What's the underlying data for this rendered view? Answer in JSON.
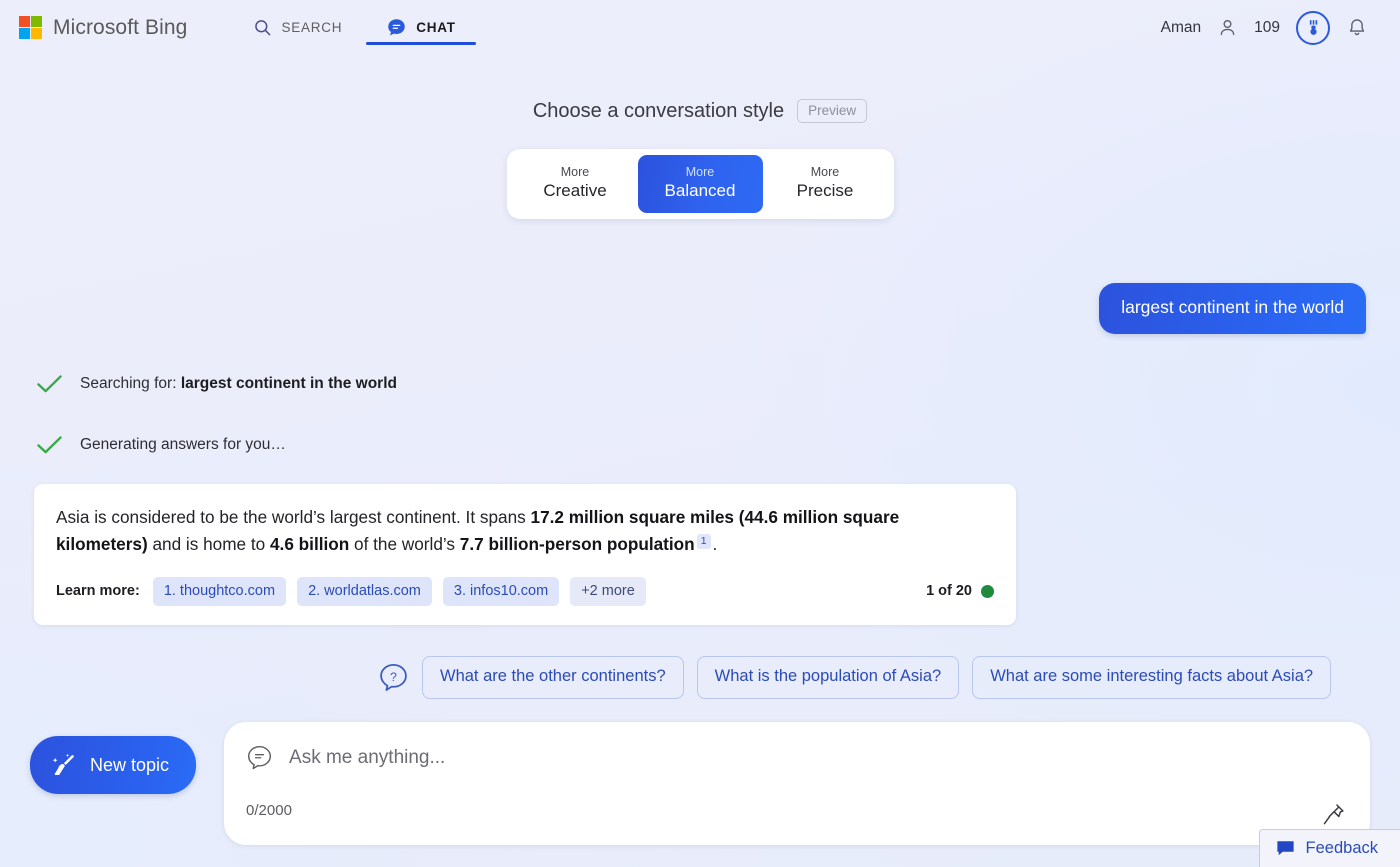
{
  "nav": {
    "brand": "Microsoft Bing",
    "brand_logo_icon": "microsoft-logo-icon",
    "tabs": [
      {
        "label": "SEARCH",
        "icon": "search-icon",
        "active": false
      },
      {
        "label": "CHAT",
        "icon": "chat-bubble-icon",
        "active": true
      }
    ],
    "account_name": "Aman",
    "account_icon": "person-icon",
    "points": "109",
    "rewards_icon": "rewards-medal-icon",
    "notifications_icon": "bell-icon"
  },
  "style_picker": {
    "title": "Choose a conversation style",
    "preview_badge": "Preview",
    "options": [
      {
        "small": "More",
        "large": "Creative",
        "selected": false
      },
      {
        "small": "More",
        "large": "Balanced",
        "selected": true
      },
      {
        "small": "More",
        "large": "Precise",
        "selected": false
      }
    ],
    "selected_index": 1
  },
  "conversation": {
    "user_message": "largest continent in the world",
    "status_lines": [
      {
        "icon": "check-icon",
        "prefix": "Searching for: ",
        "bold": "largest continent in the world"
      },
      {
        "icon": "check-icon",
        "prefix": "Generating answers for you…",
        "bold": ""
      }
    ],
    "answer": {
      "segments": [
        {
          "text": "Asia is considered to be the world’s largest continent. It spans ",
          "bold": false
        },
        {
          "text": "17.2 million square miles (44.6 million square kilometers)",
          "bold": true
        },
        {
          "text": " and is home to ",
          "bold": false
        },
        {
          "text": "4.6 billion",
          "bold": true
        },
        {
          "text": " of the world’s ",
          "bold": false
        },
        {
          "text": "7.7 billion-person population",
          "bold": true
        }
      ],
      "citation_marker": "1",
      "trailing": ".",
      "learn_more_label": "Learn more:",
      "sources": [
        "1. thoughtco.com",
        "2. worldatlas.com",
        "3. infos10.com"
      ],
      "more_sources_label": "+2 more",
      "counter": "1 of 20",
      "counter_dot_color": "#1d8a3c"
    },
    "suggestions_icon": "question-bubble-icon",
    "suggestions": [
      "What are the other continents?",
      "What is the population of Asia?",
      "What are some interesting facts about Asia?"
    ]
  },
  "composer": {
    "new_topic_label": "New topic",
    "new_topic_icon": "broom-icon",
    "input_icon": "chat-bubble-outline-icon",
    "input_value": "",
    "input_placeholder": "Ask me anything...",
    "char_count": "0/2000",
    "pin_icon": "pin-icon"
  },
  "feedback": {
    "label": "Feedback",
    "icon": "feedback-bubble-icon"
  },
  "colors": {
    "accent_blue": "#2a62ef",
    "deep_blue": "#2c52dd",
    "link_blue": "#2b4bb8",
    "chip_bg": "#dee5fa",
    "check_green": "#39a847",
    "status_green": "#1d8a3c"
  }
}
